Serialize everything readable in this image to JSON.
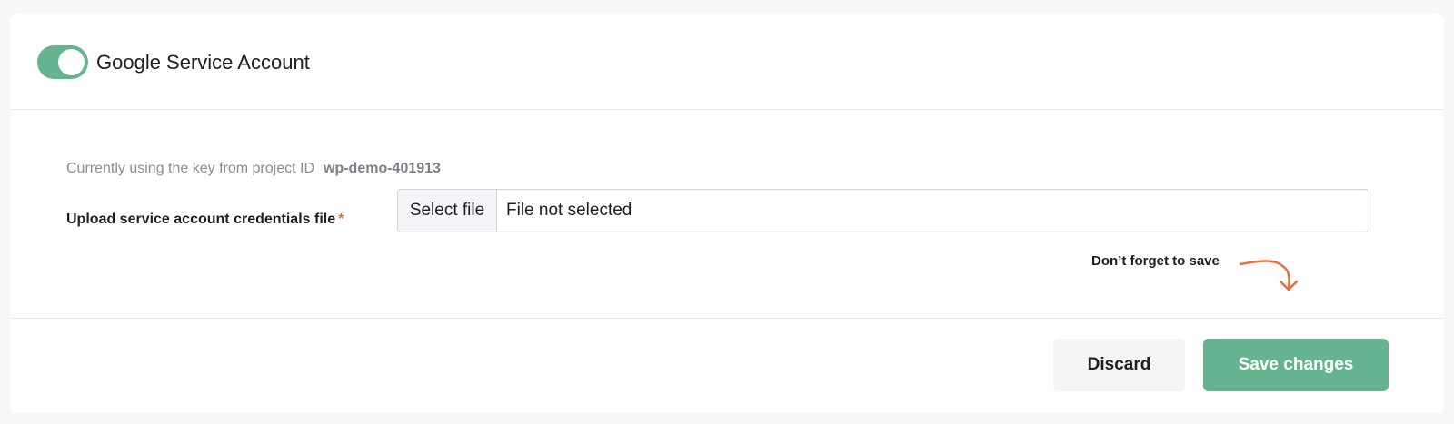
{
  "header": {
    "toggle_on": true,
    "title": "Google Service Account"
  },
  "credentials": {
    "current_key_text": "Currently using the key from project ID",
    "project_id": "wp-demo-401913",
    "upload_label": "Upload service account credentials file",
    "required_marker": "*",
    "select_file_label": "Select file",
    "file_status": "File not selected"
  },
  "reminder": {
    "text": "Don’t forget to save",
    "arrow_icon": "curved-arrow-down-icon"
  },
  "footer": {
    "discard_label": "Discard",
    "save_label": "Save changes"
  },
  "colors": {
    "accent": "#66b48f",
    "required": "#e8703a",
    "arrow": "#e8703a"
  }
}
